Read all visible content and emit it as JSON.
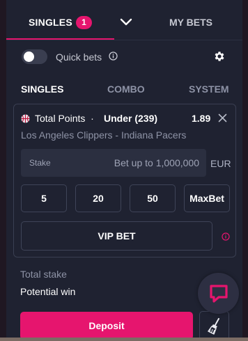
{
  "header": {
    "singles_tab": "SINGLES",
    "singles_count": "1",
    "my_bets_tab": "MY BETS"
  },
  "quick_bets": {
    "label": "Quick bets",
    "enabled": false
  },
  "bet_types": [
    "SINGLES",
    "COMBO",
    "SYSTEM"
  ],
  "bet": {
    "market": "Total Points",
    "separator": "·",
    "selection": "Under (239)",
    "odds": "1.89",
    "match": "Los Angeles Clippers - Indiana Pacers"
  },
  "stake": {
    "label": "Stake",
    "placeholder": "Bet up to 1,000,000",
    "currency": "EUR"
  },
  "quick_amounts": [
    "5",
    "20",
    "50",
    "MaxBet"
  ],
  "vip_button": "VIP BET",
  "summary": {
    "total_stake_label": "Total stake",
    "potential_win_label": "Potential win"
  },
  "deposit_button": "Deposit",
  "colors": {
    "accent": "#e6156e",
    "panel": "#1f2231",
    "muted": "#8e93a6"
  }
}
